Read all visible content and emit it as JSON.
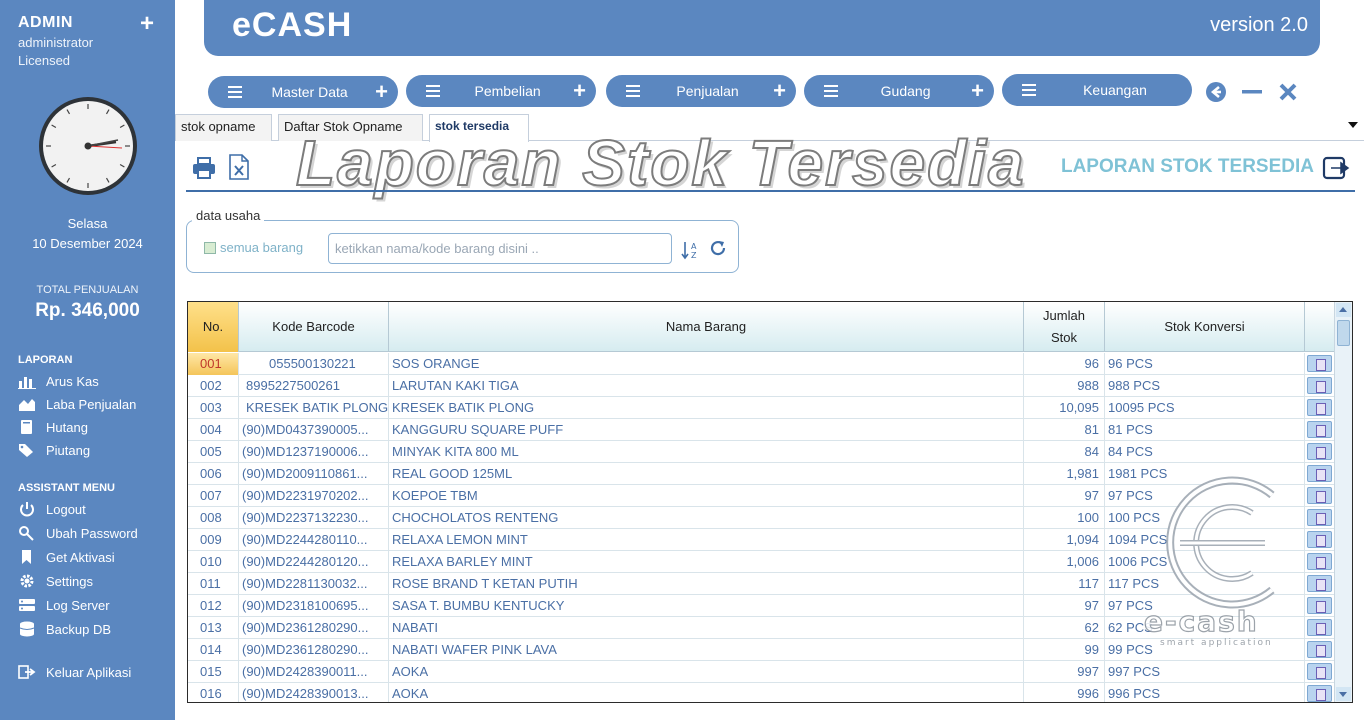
{
  "sidebar": {
    "user_name": "ADMIN",
    "user_role": "administrator",
    "license": "Licensed",
    "day": "Selasa",
    "date": "10 Desember 2024",
    "total_label": "TOTAL PENJUALAN",
    "total_value": "Rp. 346,000",
    "laporan_title": "LAPORAN",
    "laporan_items": [
      "Arus Kas",
      "Laba Penjualan",
      "Hutang",
      "Piutang"
    ],
    "assistant_title": "ASSISTANT MENU",
    "assistant_items": [
      "Logout",
      "Ubah Password",
      "Get Aktivasi",
      "Settings",
      "Log Server",
      "Backup DB"
    ],
    "exit_label": "Keluar Aplikasi"
  },
  "header": {
    "app_name": "eCASH",
    "version": "version 2.0"
  },
  "menus": [
    "Master Data",
    "Pembelian",
    "Penjualan",
    "Gudang",
    "Keuangan"
  ],
  "tabs": [
    "stok opname",
    "Daftar Stok Opname",
    "stok tersedia"
  ],
  "content": {
    "big_title": "Laporan Stok Tersedia",
    "report_title": "LAPORAN STOK TERSEDIA",
    "filter_legend": "data usaha",
    "checkbox_label": "semua barang",
    "search_placeholder": "ketikkan nama/kode barang disini .."
  },
  "table": {
    "headers": [
      "No.",
      "Kode Barcode",
      "Nama Barang",
      "Jumlah Stok",
      "Stok Konversi"
    ],
    "rows": [
      [
        "001",
        "055500130221",
        "SOS ORANGE",
        "96",
        "96 PCS"
      ],
      [
        "002",
        "8995227500261",
        "LARUTAN KAKI TIGA",
        "988",
        "988 PCS"
      ],
      [
        "003",
        "KRESEK BATIK PLONG",
        "KRESEK BATIK PLONG",
        "10,095",
        "10095 PCS"
      ],
      [
        "004",
        "(90)MD0437390005...",
        "KANGGURU SQUARE PUFF",
        "81",
        "81 PCS"
      ],
      [
        "005",
        "(90)MD1237190006...",
        "MINYAK KITA 800 ML",
        "84",
        "84 PCS"
      ],
      [
        "006",
        "(90)MD2009110861...",
        "REAL GOOD 125ML",
        "1,981",
        "1981 PCS"
      ],
      [
        "007",
        "(90)MD2231970202...",
        "KOEPOE TBM",
        "97",
        "97 PCS"
      ],
      [
        "008",
        "(90)MD2237132230...",
        "CHOCHOLATOS RENTENG",
        "100",
        "100 PCS"
      ],
      [
        "009",
        "(90)MD2244280110...",
        "RELAXA LEMON MINT",
        "1,094",
        "1094 PCS"
      ],
      [
        "010",
        "(90)MD2244280120...",
        "RELAXA BARLEY MINT",
        "1,006",
        "1006 PCS"
      ],
      [
        "011",
        "(90)MD2281130032...",
        "ROSE BRAND T KETAN PUTIH",
        "117",
        "117 PCS"
      ],
      [
        "012",
        "(90)MD2318100695...",
        "SASA T. BUMBU KENTUCKY",
        "97",
        "97 PCS"
      ],
      [
        "013",
        "(90)MD2361280290...",
        "NABATI",
        "62",
        "62 PCS"
      ],
      [
        "014",
        "(90)MD2361280290...",
        "NABATI WAFER PINK LAVA",
        "99",
        "99 PCS"
      ],
      [
        "015",
        "(90)MD2428390011...",
        "AOKA",
        "997",
        "997 PCS"
      ],
      [
        "016",
        "(90)MD2428390013...",
        "AOKA",
        "996",
        "996 PCS"
      ]
    ]
  },
  "watermark": {
    "brand": "e-cash",
    "tagline": "smart application"
  },
  "colors": {
    "primary": "#5b87c0",
    "accent": "#7fc2d6",
    "text_blue": "#4a6fa5"
  }
}
